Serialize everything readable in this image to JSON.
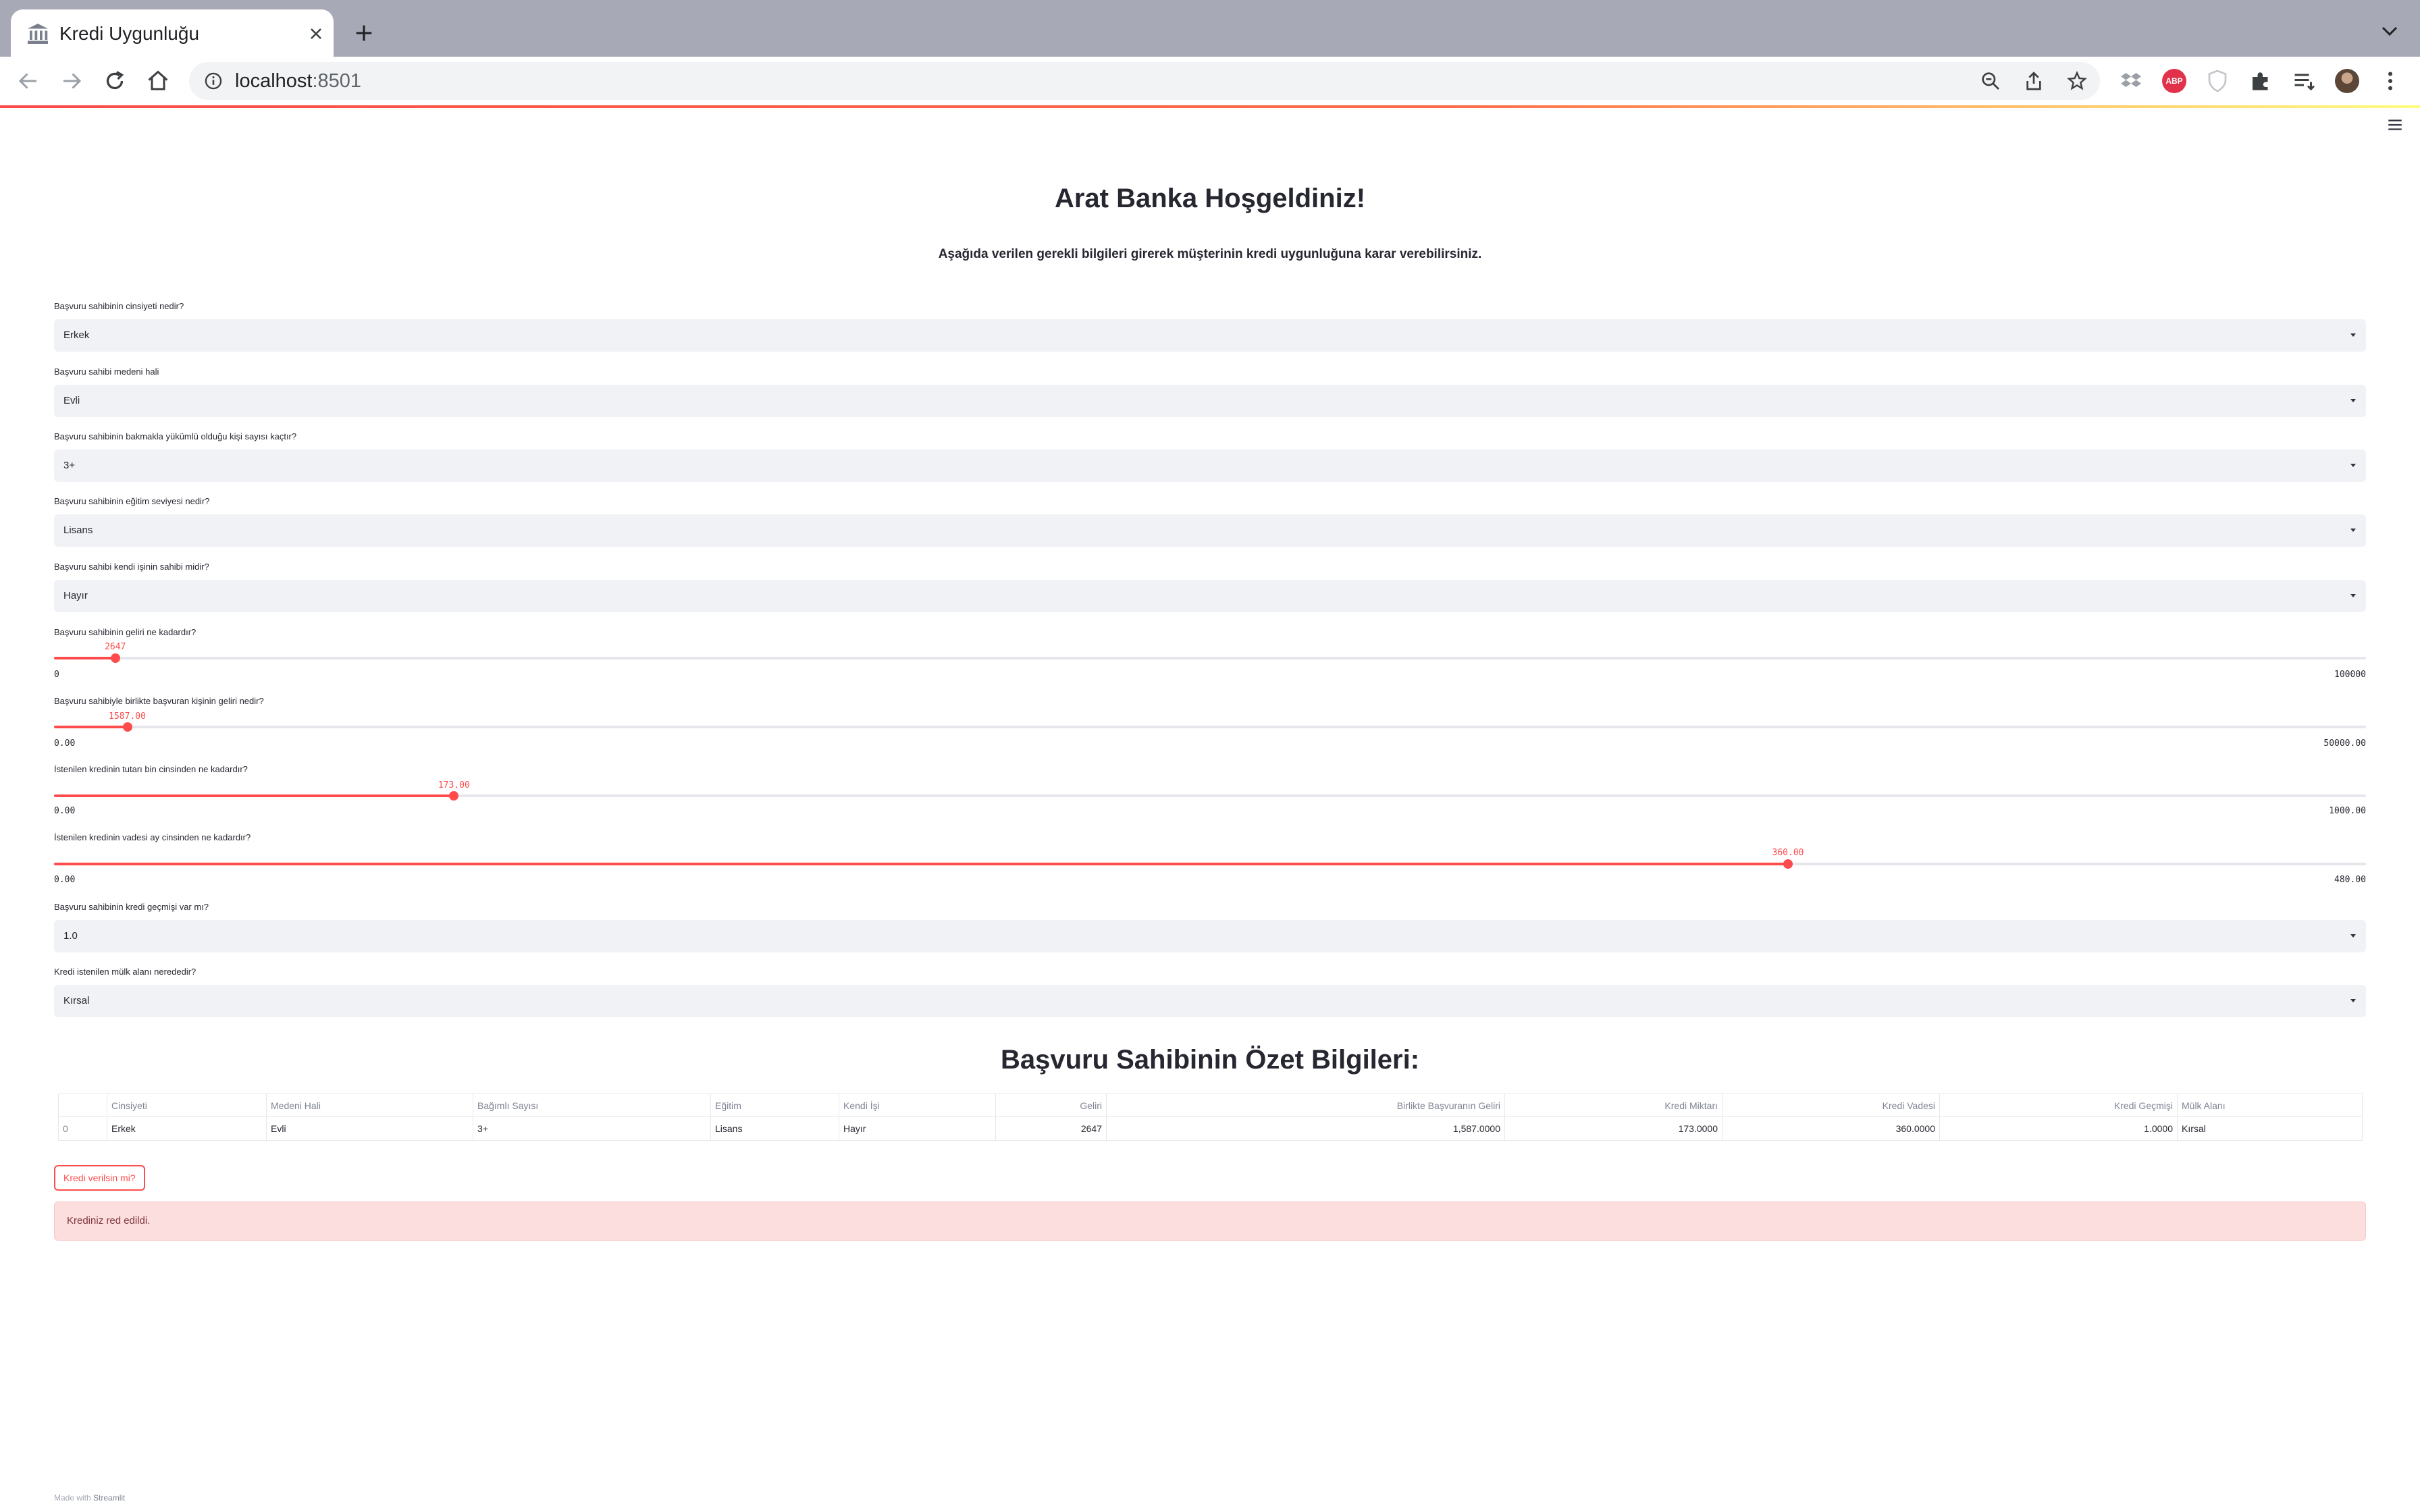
{
  "browser": {
    "tab_title": "Kredi Uygunluğu",
    "url_host": "localhost",
    "url_port": ":8501",
    "extension_badge": "ABP"
  },
  "page": {
    "title": "Arat Banka Hoşgeldiniz!",
    "subtitle": "Aşağıda verilen gerekli bilgileri girerek müşterinin kredi uygunluğuna karar verebilirsiniz."
  },
  "form": {
    "gender": {
      "label": "Başvuru sahibinin cinsiyeti nedir?",
      "value": "Erkek"
    },
    "marital": {
      "label": "Başvuru sahibi medeni hali",
      "value": "Evli"
    },
    "dependents": {
      "label": "Başvuru sahibinin bakmakla yükümlü olduğu kişi sayısı kaçtır?",
      "value": "3+"
    },
    "education": {
      "label": "Başvuru sahibinin eğitim seviyesi nedir?",
      "value": "Lisans"
    },
    "self_employed": {
      "label": "Başvuru sahibi kendi işinin sahibi midir?",
      "value": "Hayır"
    },
    "income": {
      "label": "Başvuru sahibinin geliri ne kadardır?",
      "value": "2647",
      "min": "0",
      "max": "100000",
      "fraction": 0.0265
    },
    "coapplicant_income": {
      "label": "Başvuru sahibiyle birlikte başvuran kişinin geliri nedir?",
      "value": "1587.00",
      "min": "0.00",
      "max": "50000.00",
      "fraction": 0.0317
    },
    "loan_amount": {
      "label": "İstenilen kredinin tutarı bin cinsinden ne kadardır?",
      "value": "173.00",
      "min": "0.00",
      "max": "1000.00",
      "fraction": 0.173
    },
    "loan_term": {
      "label": "İstenilen kredinin vadesi ay cinsinden ne kadardır?",
      "value": "360.00",
      "min": "0.00",
      "max": "480.00",
      "fraction": 0.75
    },
    "credit_history": {
      "label": "Başvuru sahibinin kredi geçmişi var mı?",
      "value": "1.0"
    },
    "property_area": {
      "label": "Kredi istenilen mülk alanı nerededir?",
      "value": "Kırsal"
    }
  },
  "summary": {
    "title": "Başvuru Sahibinin Özet Bilgileri:",
    "columns": [
      "",
      "Cinsiyeti",
      "Medeni Hali",
      "Bağımlı Sayısı",
      "Eğitim",
      "Kendi İşi",
      "Geliri",
      "Birlikte Başvuranın Geliri",
      "Kredi Miktarı",
      "Kredi Vadesi",
      "Kredi Geçmişi",
      "Mülk Alanı"
    ],
    "rows": [
      [
        "0",
        "Erkek",
        "Evli",
        "3+",
        "Lisans",
        "Hayır",
        "2647",
        "1,587.0000",
        "173.0000",
        "360.0000",
        "1.0000",
        "Kırsal"
      ]
    ]
  },
  "action": {
    "button_label": "Kredi verilsin mi?"
  },
  "result": {
    "message": "Krediniz red edildi."
  },
  "footer": {
    "prefix": "Made with ",
    "brand": "Streamlit"
  },
  "colors": {
    "primary": "#ff4b4b",
    "error_bg": "#fcdede",
    "error_text": "#7d353b",
    "select_bg": "#f0f2f6"
  }
}
